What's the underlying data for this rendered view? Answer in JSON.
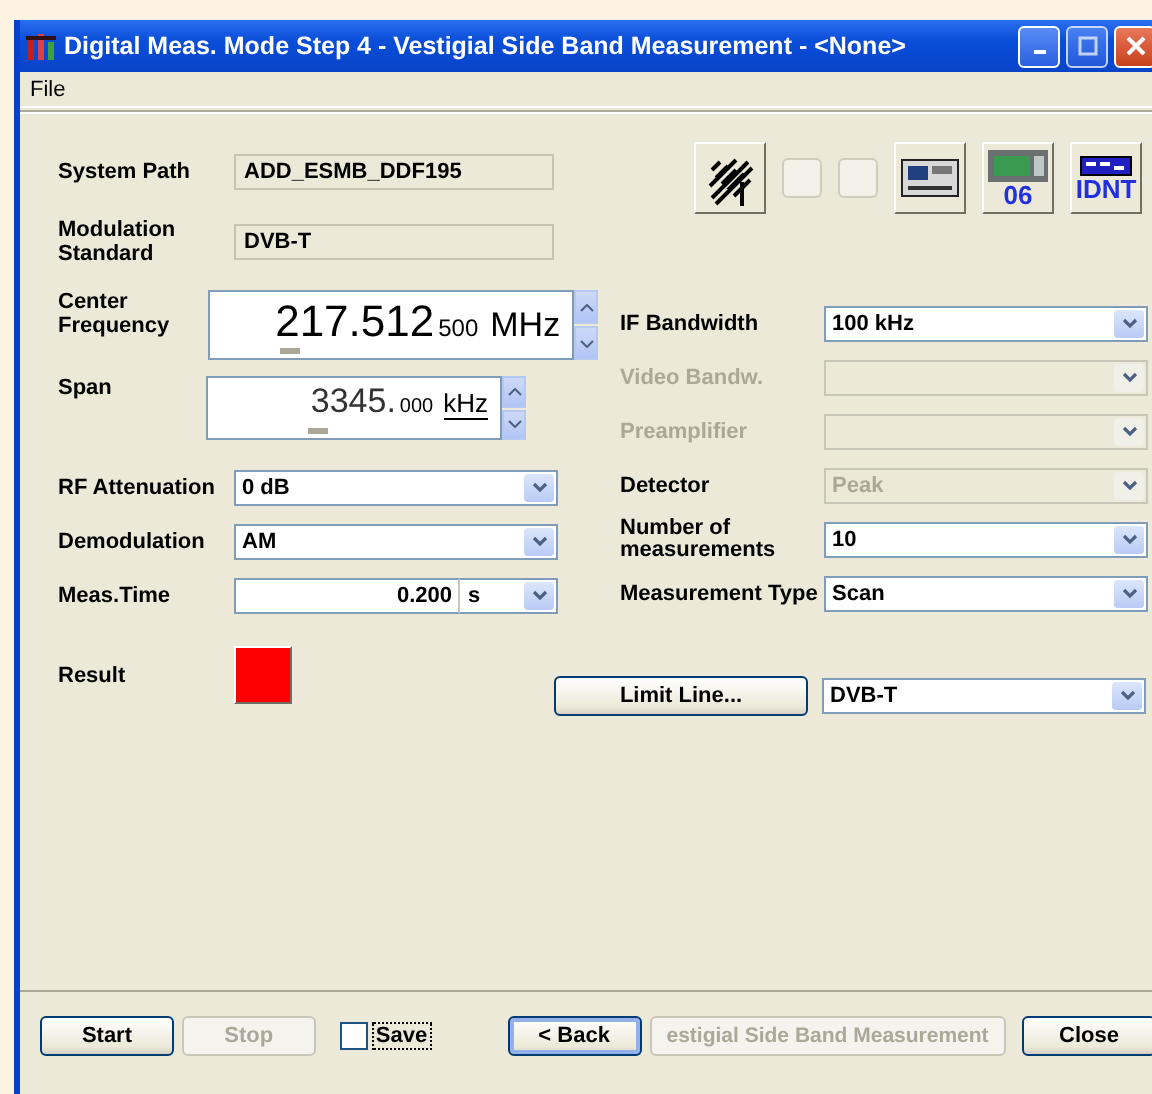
{
  "window": {
    "title": "Digital Meas. Mode Step 4 - Vestigial Side Band Measurement - <None>"
  },
  "menu": [
    {
      "label": "File"
    }
  ],
  "toolbar": [
    {
      "kind": "antenna"
    },
    {
      "kind": "blank"
    },
    {
      "kind": "blank"
    },
    {
      "kind": "receiver"
    },
    {
      "kind": "analyzer",
      "label": "06"
    },
    {
      "kind": "identify",
      "label": "IDNT"
    }
  ],
  "info": [
    {
      "label": "System Path",
      "value": "ADD_ESMB_DDF195"
    },
    {
      "label": "Modulation Standard",
      "value": "DVB-T"
    }
  ],
  "spinners": [
    {
      "kind": "large",
      "label": "Center Frequency",
      "value_main": "217.512",
      "value_fine": "500",
      "unit": "MHz"
    },
    {
      "kind": "small",
      "label": "Span",
      "value_main": "3345.",
      "value_fine": "000",
      "unit": "kHz"
    }
  ],
  "left_fields": [
    {
      "kind": "dropdown",
      "label": "RF Attenuation",
      "value": "0 dB"
    },
    {
      "kind": "dropdown",
      "label": "Demodulation",
      "value": "AM"
    },
    {
      "kind": "number-unit",
      "label": "Meas.Time",
      "value": "0.200",
      "unit": "s"
    }
  ],
  "right_fields": [
    {
      "label": "IF Bandwidth",
      "value": "100 kHz",
      "label_disabled": false,
      "disabled": false
    },
    {
      "label": "Video Bandw.",
      "label_disabled": true,
      "disabled": true
    },
    {
      "label": "Preamplifier",
      "label_disabled": true,
      "disabled": true
    },
    {
      "label": "Detector",
      "value": "Peak",
      "label_disabled": false,
      "disabled": true
    },
    {
      "label": "Number of measurements",
      "value": "10",
      "label_disabled": false,
      "disabled": false
    },
    {
      "label": "Measurement Type",
      "value": "Scan",
      "label_disabled": false,
      "disabled": false
    }
  ],
  "result": {
    "label": "Result",
    "color": "#ff0000"
  },
  "limit_line": {
    "button": "Limit Line...",
    "value": "DVB-T"
  },
  "footer": [
    {
      "kind": "button",
      "label": "Start",
      "disabled": false,
      "default": false
    },
    {
      "kind": "button",
      "label": "Stop",
      "disabled": true,
      "default": false
    },
    {
      "kind": "checkbox",
      "label": "Save",
      "checked": false
    },
    {
      "kind": "button",
      "label": "< Back",
      "disabled": false,
      "default": true
    },
    {
      "kind": "button",
      "label": "estigial Side Band Measurement",
      "disabled": true,
      "default": false
    },
    {
      "kind": "button",
      "label": "Close",
      "disabled": false,
      "default": false
    }
  ]
}
